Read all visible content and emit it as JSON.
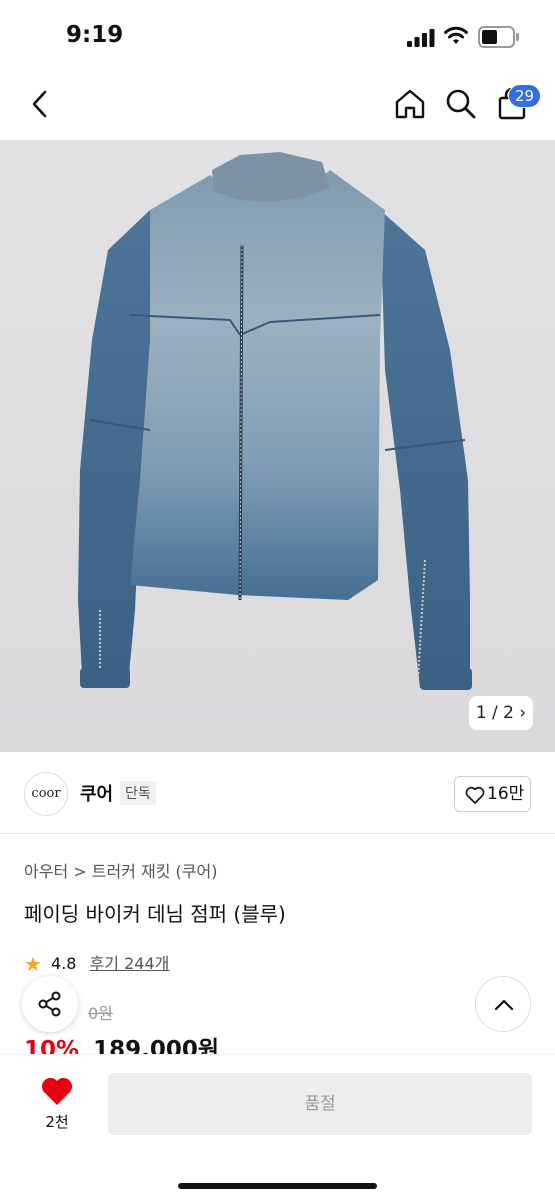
{
  "status_bar": {
    "time": "9:19"
  },
  "nav": {
    "cart_count": "29"
  },
  "gallery": {
    "pager": "1 / 2 ›"
  },
  "brand": {
    "logo_text": "coor",
    "name": "쿠어",
    "tag": "단독",
    "likes": "16만"
  },
  "breadcrumb": "아우터  >  트러커 재킷 (쿠어)",
  "product": {
    "title": "페이딩 바이커 데님 점퍼 (블루)",
    "rating": "4.8",
    "reviews": "후기 244개",
    "original_price": "0원",
    "discount": "10%",
    "price": "189,000원"
  },
  "bottom_bar": {
    "wish_count": "2천",
    "buy_label": "품절"
  },
  "colors": {
    "accent_red": "#e60012",
    "badge_blue": "#2f6ee8"
  }
}
